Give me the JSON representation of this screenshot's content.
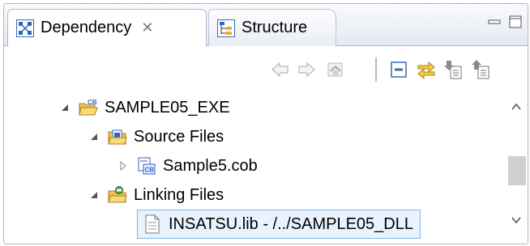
{
  "tabs": [
    {
      "label": "Dependency",
      "active": true,
      "close": "✕",
      "icon": "dependency-view-icon"
    },
    {
      "label": "Structure",
      "active": false,
      "icon": "structure-view-icon"
    }
  ],
  "window_controls": [
    "minimize-icon",
    "maximize-icon"
  ],
  "toolbar": [
    "back-icon",
    "forward-icon",
    "home-icon",
    "collapse-all-icon",
    "link-with-editor-icon",
    "import-icon",
    "export-icon"
  ],
  "tree": {
    "project": {
      "label": "SAMPLE05_EXE",
      "expanded": true,
      "icon": "cobol-project-icon"
    },
    "source_files": {
      "label": "Source Files",
      "expanded": true,
      "icon": "source-folder-icon"
    },
    "sample5": {
      "label": "Sample5.cob",
      "expanded": false,
      "icon": "cobol-file-icon"
    },
    "linking_files": {
      "label": "Linking Files",
      "expanded": true,
      "icon": "linking-folder-icon"
    },
    "insatsu": {
      "label": "INSATSU.lib - /../SAMPLE05_DLL",
      "selected": true,
      "icon": "library-file-icon"
    }
  },
  "colors": {
    "selection_border": "#7fb6e6",
    "selection_bg": "#e8f3fd",
    "frame_border": "#a9b8cf"
  }
}
